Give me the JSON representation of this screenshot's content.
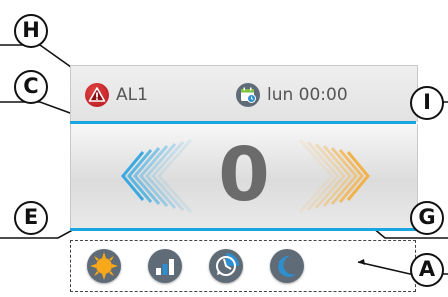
{
  "status_bar": {
    "alarm_label": "AL1",
    "schedule_label": "lun 00:00"
  },
  "main_display": {
    "value": "0"
  },
  "callouts": {
    "H": "H",
    "C": "C",
    "I": "I",
    "E": "E",
    "G": "G",
    "A": "A"
  },
  "icons": {
    "alarm": "alarm-warning-icon",
    "schedule": "calendar-clock-icon",
    "decrease": "chevron-left-icon",
    "increase": "chevron-right-icon",
    "mode_1": "sun-icon",
    "mode_2": "bar-chart-icon",
    "mode_3": "time-cycle-icon",
    "mode_4": "moon-icon"
  },
  "colors": {
    "accent_line": "#1aa6df",
    "decrease_chevron": "#3aa9e0",
    "increase_chevron": "#f2b24a",
    "alarm": "#c81e24",
    "sun": "#f7a81b",
    "value_text": "#6b6b6b"
  }
}
